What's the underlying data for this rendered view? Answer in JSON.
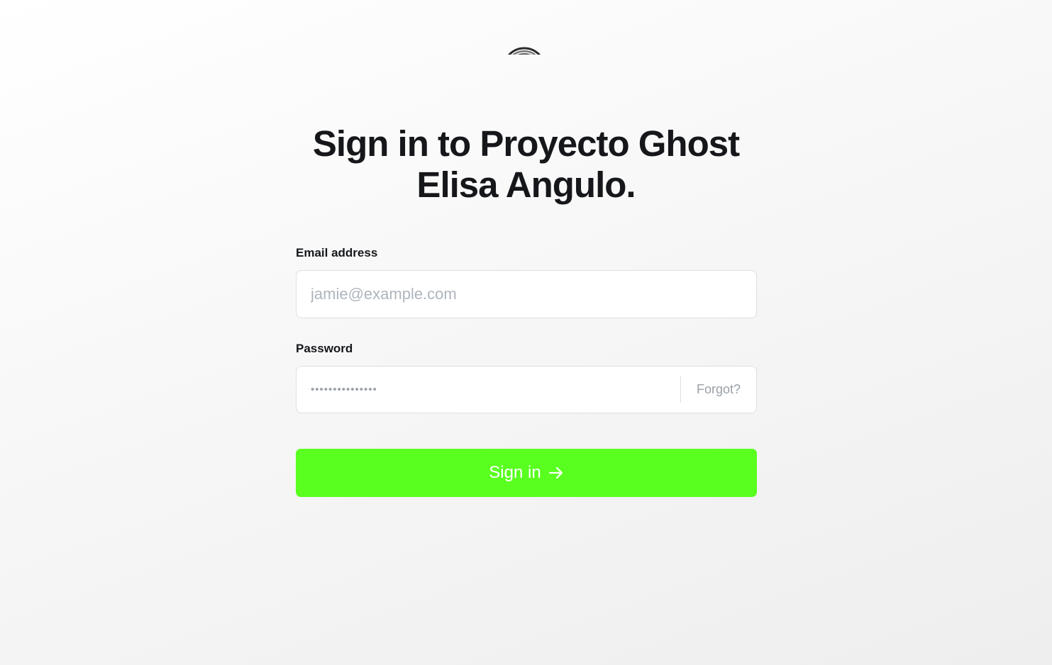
{
  "header": {
    "logo_icon": "site-logo-icon"
  },
  "title": {
    "line1": "Sign in to Proyecto Ghost",
    "line2": "Elisa Angulo."
  },
  "form": {
    "email_label": "Email address",
    "email_placeholder": "jamie@example.com",
    "email_value": "",
    "password_label": "Password",
    "password_masked": "•••••••••••••••",
    "forgot_label": "Forgot?",
    "submit_label": "Sign in",
    "submit_icon": "arrow-right-icon"
  },
  "colors": {
    "accent": "#59ff1f",
    "text": "#15171a",
    "placeholder": "#aeb5bd",
    "border": "#dcdfe3"
  }
}
